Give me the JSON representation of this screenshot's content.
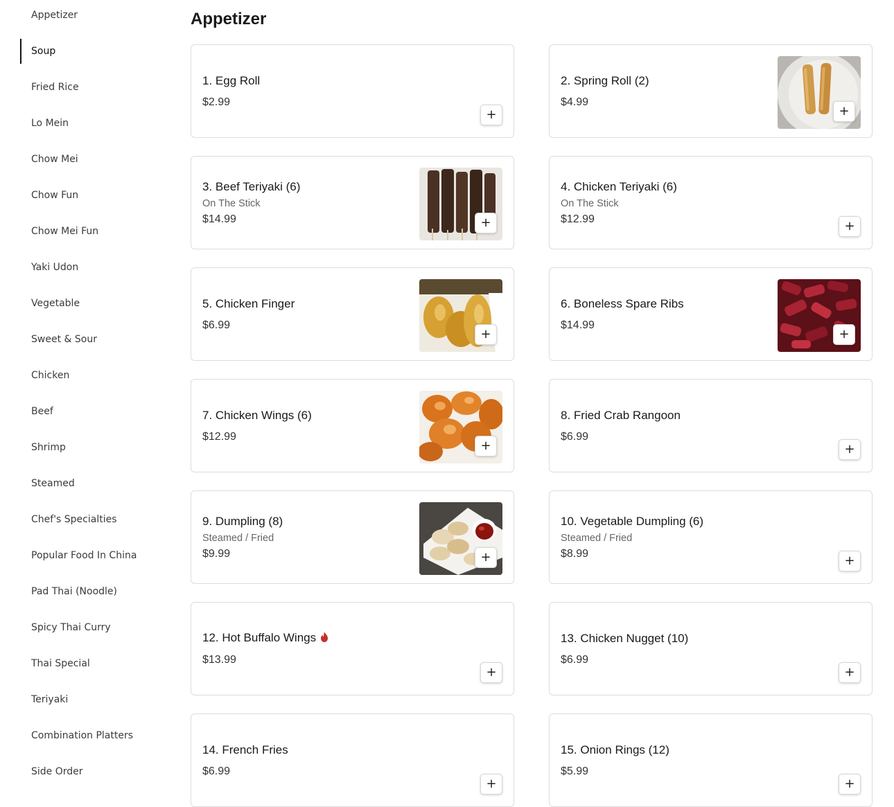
{
  "sidebar": {
    "items": [
      "Appetizer",
      "Soup",
      "Fried Rice",
      "Lo Mein",
      "Chow Mei",
      "Chow Fun",
      "Chow Mei Fun",
      "Yaki Udon",
      "Vegetable",
      "Sweet & Sour",
      "Chicken",
      "Beef",
      "Shrimp",
      "Steamed",
      "Chef's Specialties",
      "Popular Food In China",
      "Pad Thai (Noodle)",
      "Spicy Thai Curry",
      "Thai Special",
      "Teriyaki",
      "Combination Platters",
      "Side Order"
    ],
    "active": "Soup"
  },
  "section": {
    "title": "Appetizer"
  },
  "add_label": "+",
  "items": [
    {
      "name": "1. Egg Roll",
      "price": "$2.99"
    },
    {
      "name": "2. Spring Roll (2)",
      "price": "$4.99",
      "image": "spring-roll-photo"
    },
    {
      "name": "3. Beef Teriyaki (6)",
      "desc": "On The Stick",
      "price": "$14.99",
      "image": "beef-teriyaki-photo"
    },
    {
      "name": "4. Chicken Teriyaki (6)",
      "desc": "On The Stick",
      "price": "$12.99"
    },
    {
      "name": "5. Chicken Finger",
      "price": "$6.99",
      "image": "chicken-finger-photo"
    },
    {
      "name": "6. Boneless Spare Ribs",
      "price": "$14.99",
      "image": "spare-ribs-photo"
    },
    {
      "name": "7. Chicken Wings (6)",
      "price": "$12.99",
      "image": "chicken-wings-photo"
    },
    {
      "name": "8. Fried Crab Rangoon",
      "price": "$6.99"
    },
    {
      "name": "9. Dumpling (8)",
      "desc": "Steamed / Fried",
      "price": "$9.99",
      "image": "dumpling-photo"
    },
    {
      "name": "10. Vegetable Dumpling (6)",
      "desc": "Steamed / Fried",
      "price": "$8.99"
    },
    {
      "name": "12. Hot Buffalo Wings",
      "price": "$13.99",
      "icon": "spicy-fire-icon"
    },
    {
      "name": "13. Chicken Nugget (10)",
      "price": "$6.99"
    },
    {
      "name": "14. French Fries",
      "price": "$6.99"
    },
    {
      "name": "15. Onion Rings (12)",
      "price": "$5.99"
    }
  ]
}
